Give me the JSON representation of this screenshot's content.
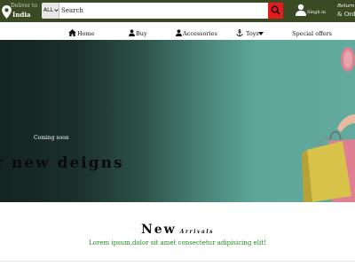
{
  "header": {
    "deliver_label": "Deliver to",
    "deliver_country": "India",
    "search": {
      "category": "ALL",
      "placeholder": "Search"
    },
    "signin_label": "Singh in",
    "returns_line1": "Return",
    "returns_line2": "& Orders"
  },
  "nav": {
    "items": [
      {
        "label": "Home",
        "icon": "home-icon"
      },
      {
        "label": "Buy",
        "icon": "user-icon"
      },
      {
        "label": "Accessories",
        "icon": "user-icon"
      },
      {
        "label": "Toys",
        "icon": "anchor-icon"
      },
      {
        "label": "Special offers",
        "icon": ""
      }
    ]
  },
  "hero": {
    "subtitle": "Coming soon",
    "title": "r new deigns"
  },
  "arrivals": {
    "title": "New",
    "subtitle": "Arrivals",
    "text": "Lorem ipsum,dolor sit amet consectetur adipisicing elit!"
  },
  "colors": {
    "topbar": "#3a4a22",
    "search_button": "#e51a1a",
    "accent_green": "#1a8a1a",
    "hero_teal": "#63aa9e"
  }
}
